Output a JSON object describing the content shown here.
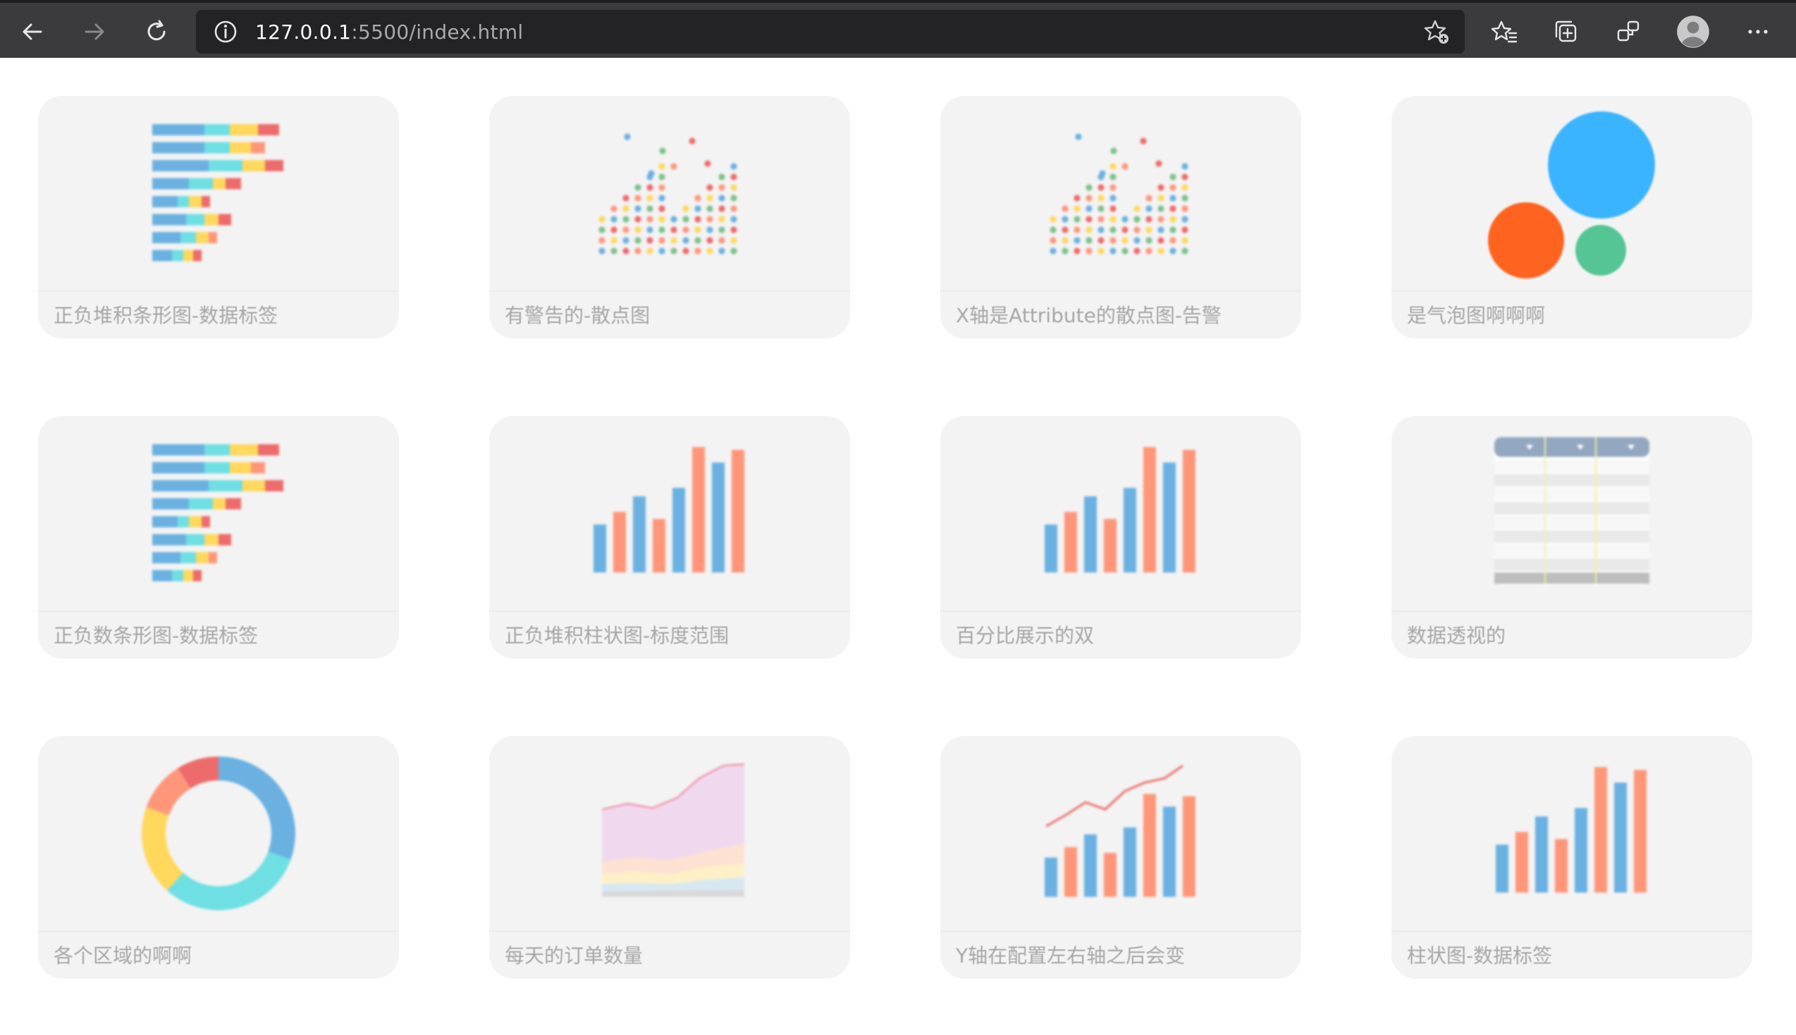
{
  "browser": {
    "url_host": "127.0.0.1",
    "url_rest": ":5500/index.html",
    "icons": {
      "back": "arrow-left-icon",
      "forward": "arrow-right-icon",
      "refresh": "refresh-icon",
      "info": "info-icon",
      "add_favorite": "star-add-icon",
      "favorites": "favorites-icon",
      "collections": "collections-icon",
      "extensions": "extensions-icon",
      "profile": "profile-avatar-icon",
      "more": "more-icon"
    }
  },
  "palette": {
    "blue": "#6ab1e1",
    "salmon": "#ff967a",
    "cyan": "#6edfe3",
    "yellow": "#ffd85c",
    "red": "#ee6b6b",
    "green": "#7cc28a",
    "bubble_blue": "#3ab4ff",
    "bubble_orange": "#ff6320",
    "bubble_green": "#55c596"
  },
  "cards": [
    {
      "title": "正负堆积条形图-数据标签",
      "thumb": "stacked-bar-thumbnail"
    },
    {
      "title": "有警告的-散点图",
      "thumb": "scatter-thumbnail"
    },
    {
      "title": "X轴是Attribute的散点图-告警",
      "thumb": "scatter-thumbnail"
    },
    {
      "title": "是气泡图啊啊啊",
      "thumb": "bubble-thumbnail"
    },
    {
      "title": "正负数条形图-数据标签",
      "thumb": "stacked-bar-thumbnail"
    },
    {
      "title": "正负堆积柱状图-标度范围",
      "thumb": "column-thumbnail"
    },
    {
      "title": "百分比展示的双",
      "thumb": "column-thumbnail"
    },
    {
      "title": "数据透视的",
      "thumb": "pivot-table-thumbnail"
    },
    {
      "title": "各个区域的啊啊",
      "thumb": "donut-thumbnail"
    },
    {
      "title": "每天的订单数量",
      "thumb": "area-thumbnail"
    },
    {
      "title": "Y轴在配置左右轴之后会变",
      "thumb": "column-line-thumbnail"
    },
    {
      "title": "柱状图-数据标签",
      "thumb": "column-thumbnail"
    }
  ]
}
